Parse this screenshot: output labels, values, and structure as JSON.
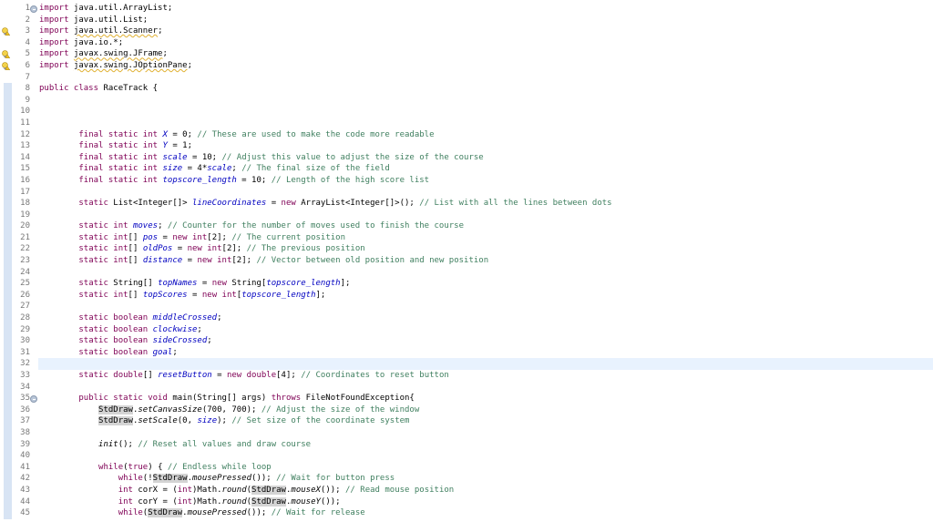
{
  "editor": {
    "current_line": 32,
    "warning_lines": [
      3,
      5,
      6
    ],
    "fold_lines": [
      1,
      35
    ],
    "scope_start": 8,
    "lines": [
      [
        [
          "k",
          "import"
        ],
        [
          "p",
          " java.util.ArrayList;"
        ]
      ],
      [
        [
          "k",
          "import"
        ],
        [
          "p",
          " java.util.List;"
        ]
      ],
      [
        [
          "k",
          "import"
        ],
        [
          "p",
          " "
        ],
        [
          "w",
          "java.util.Scanner"
        ],
        [
          "p",
          ";"
        ]
      ],
      [
        [
          "k",
          "import"
        ],
        [
          "p",
          " java.io.*;"
        ]
      ],
      [
        [
          "k",
          "import"
        ],
        [
          "p",
          " "
        ],
        [
          "w",
          "javax.swing.JFrame"
        ],
        [
          "p",
          ";"
        ]
      ],
      [
        [
          "k",
          "import"
        ],
        [
          "p",
          " "
        ],
        [
          "w",
          "javax.swing.JOptionPane"
        ],
        [
          "p",
          ";"
        ]
      ],
      [],
      [
        [
          "k",
          "public class"
        ],
        [
          "p",
          " RaceTrack {"
        ]
      ],
      [],
      [],
      [],
      [
        [
          "p",
          "        "
        ],
        [
          "k",
          "final static int"
        ],
        [
          "p",
          " "
        ],
        [
          "f",
          "X"
        ],
        [
          "p",
          " = 0; "
        ],
        [
          "c",
          "// These are used to make the code more readable"
        ]
      ],
      [
        [
          "p",
          "        "
        ],
        [
          "k",
          "final static int"
        ],
        [
          "p",
          " "
        ],
        [
          "f",
          "Y"
        ],
        [
          "p",
          " = 1;"
        ]
      ],
      [
        [
          "p",
          "        "
        ],
        [
          "k",
          "final static int"
        ],
        [
          "p",
          " "
        ],
        [
          "f",
          "scale"
        ],
        [
          "p",
          " = 10; "
        ],
        [
          "c",
          "// Adjust this value to adjust the size of the course"
        ]
      ],
      [
        [
          "p",
          "        "
        ],
        [
          "k",
          "final static int"
        ],
        [
          "p",
          " "
        ],
        [
          "f",
          "size"
        ],
        [
          "p",
          " = 4*"
        ],
        [
          "f",
          "scale"
        ],
        [
          "p",
          "; "
        ],
        [
          "c",
          "// The final size of the field"
        ]
      ],
      [
        [
          "p",
          "        "
        ],
        [
          "k",
          "final static int"
        ],
        [
          "p",
          " "
        ],
        [
          "f",
          "topscore_length"
        ],
        [
          "p",
          " = 10; "
        ],
        [
          "c",
          "// Length of the high score list"
        ]
      ],
      [],
      [
        [
          "p",
          "        "
        ],
        [
          "k",
          "static"
        ],
        [
          "p",
          " List<Integer[]> "
        ],
        [
          "f",
          "lineCoordinates"
        ],
        [
          "p",
          " = "
        ],
        [
          "k",
          "new"
        ],
        [
          "p",
          " ArrayList<Integer[]>(); "
        ],
        [
          "c",
          "// List with all the lines between dots"
        ]
      ],
      [],
      [
        [
          "p",
          "        "
        ],
        [
          "k",
          "static int"
        ],
        [
          "p",
          " "
        ],
        [
          "f",
          "moves"
        ],
        [
          "p",
          "; "
        ],
        [
          "c",
          "// Counter for the number of moves used to finish the course"
        ]
      ],
      [
        [
          "p",
          "        "
        ],
        [
          "k",
          "static int"
        ],
        [
          "p",
          "[] "
        ],
        [
          "f",
          "pos"
        ],
        [
          "p",
          " = "
        ],
        [
          "k",
          "new int"
        ],
        [
          "p",
          "[2]; "
        ],
        [
          "c",
          "// The current position"
        ]
      ],
      [
        [
          "p",
          "        "
        ],
        [
          "k",
          "static int"
        ],
        [
          "p",
          "[] "
        ],
        [
          "f",
          "oldPos"
        ],
        [
          "p",
          " = "
        ],
        [
          "k",
          "new int"
        ],
        [
          "p",
          "[2]; "
        ],
        [
          "c",
          "// The previous position"
        ]
      ],
      [
        [
          "p",
          "        "
        ],
        [
          "k",
          "static int"
        ],
        [
          "p",
          "[] "
        ],
        [
          "f",
          "distance"
        ],
        [
          "p",
          " = "
        ],
        [
          "k",
          "new int"
        ],
        [
          "p",
          "[2]; "
        ],
        [
          "c",
          "// Vector between old position and new position"
        ]
      ],
      [],
      [
        [
          "p",
          "        "
        ],
        [
          "k",
          "static"
        ],
        [
          "p",
          " String[] "
        ],
        [
          "f",
          "topNames"
        ],
        [
          "p",
          " = "
        ],
        [
          "k",
          "new"
        ],
        [
          "p",
          " String["
        ],
        [
          "f",
          "topscore_length"
        ],
        [
          "p",
          "];"
        ]
      ],
      [
        [
          "p",
          "        "
        ],
        [
          "k",
          "static int"
        ],
        [
          "p",
          "[] "
        ],
        [
          "f",
          "topScores"
        ],
        [
          "p",
          " = "
        ],
        [
          "k",
          "new int"
        ],
        [
          "p",
          "["
        ],
        [
          "f",
          "topscore_length"
        ],
        [
          "p",
          "];"
        ]
      ],
      [],
      [
        [
          "p",
          "        "
        ],
        [
          "k",
          "static boolean"
        ],
        [
          "p",
          " "
        ],
        [
          "f",
          "middleCrossed"
        ],
        [
          "p",
          ";"
        ]
      ],
      [
        [
          "p",
          "        "
        ],
        [
          "k",
          "static boolean"
        ],
        [
          "p",
          " "
        ],
        [
          "f",
          "clockwise"
        ],
        [
          "p",
          ";"
        ]
      ],
      [
        [
          "p",
          "        "
        ],
        [
          "k",
          "static boolean"
        ],
        [
          "p",
          " "
        ],
        [
          "f",
          "sideCrossed"
        ],
        [
          "p",
          ";"
        ]
      ],
      [
        [
          "p",
          "        "
        ],
        [
          "k",
          "static boolean"
        ],
        [
          "p",
          " "
        ],
        [
          "f",
          "goal"
        ],
        [
          "p",
          ";"
        ]
      ],
      [],
      [
        [
          "p",
          "        "
        ],
        [
          "k",
          "static double"
        ],
        [
          "p",
          "[] "
        ],
        [
          "f",
          "resetButton"
        ],
        [
          "p",
          " = "
        ],
        [
          "k",
          "new double"
        ],
        [
          "p",
          "[4]; "
        ],
        [
          "c",
          "// Coordinates to reset button"
        ]
      ],
      [],
      [
        [
          "p",
          "        "
        ],
        [
          "k",
          "public static void"
        ],
        [
          "p",
          " main(String[] args) "
        ],
        [
          "k",
          "throws"
        ],
        [
          "p",
          " FileNotFoundException{"
        ]
      ],
      [
        [
          "p",
          "            "
        ],
        [
          "h",
          "StdDraw"
        ],
        [
          "p",
          "."
        ],
        [
          "i",
          "setCanvasSize"
        ],
        [
          "p",
          "(700, 700); "
        ],
        [
          "c",
          "// Adjust the size of the window"
        ]
      ],
      [
        [
          "p",
          "            "
        ],
        [
          "h",
          "StdDraw"
        ],
        [
          "p",
          "."
        ],
        [
          "i",
          "setScale"
        ],
        [
          "p",
          "(0, "
        ],
        [
          "f",
          "size"
        ],
        [
          "p",
          "); "
        ],
        [
          "c",
          "// Set size of the coordinate system"
        ]
      ],
      [],
      [
        [
          "p",
          "            "
        ],
        [
          "i",
          "init"
        ],
        [
          "p",
          "(); "
        ],
        [
          "c",
          "// Reset all values and draw course"
        ]
      ],
      [],
      [
        [
          "p",
          "            "
        ],
        [
          "k",
          "while"
        ],
        [
          "p",
          "("
        ],
        [
          "k",
          "true"
        ],
        [
          "p",
          ") { "
        ],
        [
          "c",
          "// Endless while loop"
        ]
      ],
      [
        [
          "p",
          "                "
        ],
        [
          "k",
          "while"
        ],
        [
          "p",
          "(!"
        ],
        [
          "h",
          "StdDraw"
        ],
        [
          "p",
          "."
        ],
        [
          "i",
          "mousePressed"
        ],
        [
          "p",
          "()); "
        ],
        [
          "c",
          "// Wait for button press"
        ]
      ],
      [
        [
          "p",
          "                "
        ],
        [
          "k",
          "int"
        ],
        [
          "p",
          " corX = ("
        ],
        [
          "k",
          "int"
        ],
        [
          "p",
          ")Math."
        ],
        [
          "i",
          "round"
        ],
        [
          "p",
          "("
        ],
        [
          "h",
          "StdDraw"
        ],
        [
          "p",
          "."
        ],
        [
          "i",
          "mouseX"
        ],
        [
          "p",
          "()); "
        ],
        [
          "c",
          "// Read mouse position"
        ]
      ],
      [
        [
          "p",
          "                "
        ],
        [
          "k",
          "int"
        ],
        [
          "p",
          " corY = ("
        ],
        [
          "k",
          "int"
        ],
        [
          "p",
          ")Math."
        ],
        [
          "i",
          "round"
        ],
        [
          "p",
          "("
        ],
        [
          "h",
          "StdDraw"
        ],
        [
          "p",
          "."
        ],
        [
          "i",
          "mouseY"
        ],
        [
          "p",
          "());"
        ]
      ],
      [
        [
          "p",
          "                "
        ],
        [
          "k",
          "while"
        ],
        [
          "p",
          "("
        ],
        [
          "h",
          "StdDraw"
        ],
        [
          "p",
          "."
        ],
        [
          "i",
          "mousePressed"
        ],
        [
          "p",
          "()); "
        ],
        [
          "c",
          "// Wait for release"
        ]
      ]
    ]
  }
}
